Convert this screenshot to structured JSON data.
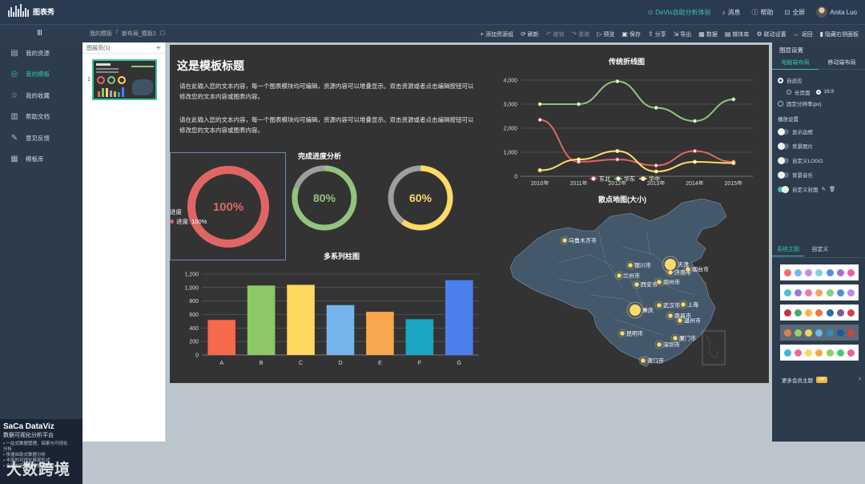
{
  "app": {
    "logo_text": "图表秀",
    "davis_link": "DeVis自助分析体验",
    "messages": "消息",
    "help": "帮助",
    "fullscreen": "全屏",
    "user": "Anita Luo"
  },
  "toolbar": {
    "home_icon": "Ⅲ",
    "breadcrumb": [
      "我的模板",
      "/",
      "新布局_模板2"
    ],
    "items": [
      {
        "icon": "+",
        "label": "添加资源组",
        "dim": false
      },
      {
        "icon": "⟳",
        "label": "刷新",
        "dim": false
      },
      {
        "icon": "↶",
        "label": "撤销",
        "dim": true
      },
      {
        "icon": "↷",
        "label": "重做",
        "dim": true
      },
      {
        "icon": "▷",
        "label": "预览",
        "dim": false
      },
      {
        "icon": "▣",
        "label": "保存",
        "dim": false
      },
      {
        "icon": "⇪",
        "label": "分享",
        "dim": false
      },
      {
        "icon": "⇲",
        "label": "导出",
        "dim": false
      },
      {
        "icon": "▦",
        "label": "数据",
        "dim": false
      },
      {
        "icon": "▤",
        "label": "媒体库",
        "dim": false
      },
      {
        "icon": "⚙",
        "label": "联动设置",
        "dim": false
      },
      {
        "icon": "←",
        "label": "返回",
        "dim": false
      },
      {
        "icon": "▮",
        "label": "隐藏右侧面板",
        "dim": false
      }
    ]
  },
  "sidebar": {
    "items": [
      {
        "icon": "▤",
        "label": "我的资源",
        "active": false
      },
      {
        "icon": "◎",
        "label": "我的模板",
        "active": true
      },
      {
        "icon": "☆",
        "label": "我的收藏",
        "active": false
      },
      {
        "icon": "▥",
        "label": "帮助文档",
        "active": false
      },
      {
        "icon": "✎",
        "label": "意见反馈",
        "active": false
      },
      {
        "icon": "▦",
        "label": "模板库",
        "active": false
      }
    ],
    "promo": {
      "title": "SaCa DataViz",
      "subtitle": "数据可视化分析平台",
      "lines": [
        "• 一站式数据管理、探索与可视化",
        "  分析",
        "• 快速自助式数据分析",
        "• 丰富的可视化展现形式",
        "• 全面的用户权限管理体系"
      ]
    },
    "watermark": "大数跨境"
  },
  "pages": {
    "header": "图层页(1)",
    "add": "+",
    "page_number": "1"
  },
  "dashboard": {
    "title": "这是模板标题",
    "paragraphs": [
      "请在此输入您的文本内容，每一个图表模块均可编辑，资源内容可以堆叠显示。双击资源或者点击编辑按钮可以修改您的文本内容或图表内容。",
      "请在此输入您的文本内容，每一个图表模块均可编辑，资源内容可以堆叠显示。双击资源或者点击编辑按钮可以修改您的文本内容或图表内容。"
    ],
    "progress_title": "完成进度分析",
    "tooltip_title": "进度",
    "tooltip_text": "进度: 100%",
    "gauges": [
      {
        "value": 100,
        "label": "100%",
        "color": "#e06666",
        "track": "#a94545"
      },
      {
        "value": 80,
        "label": "80%",
        "color": "#93c47d",
        "track": "#9e9e9e"
      },
      {
        "value": 60,
        "label": "60%",
        "color": "#ffd966",
        "track": "#9e9e9e"
      }
    ],
    "map_title": "散点地图(大小)",
    "map_cities": [
      {
        "name": "乌鲁木齐市",
        "big": false
      },
      {
        "name": "银川市",
        "big": false
      },
      {
        "name": "兰州市",
        "big": false
      },
      {
        "name": "西安市",
        "big": false
      },
      {
        "name": "郑州市",
        "big": false
      },
      {
        "name": "济南市",
        "big": false
      },
      {
        "name": "天津",
        "big": true
      },
      {
        "name": "烟台市",
        "big": false
      },
      {
        "name": "重庆",
        "big": true
      },
      {
        "name": "武汉市",
        "big": false
      },
      {
        "name": "上海",
        "big": false
      },
      {
        "name": "南昌市",
        "big": false
      },
      {
        "name": "温州市",
        "big": false
      },
      {
        "name": "昆明市",
        "big": false
      },
      {
        "name": "厦门市",
        "big": false
      },
      {
        "name": "深圳市",
        "big": false
      },
      {
        "name": "海口市",
        "big": false
      }
    ]
  },
  "chart_data": [
    {
      "type": "line",
      "title": "传统折线图",
      "categories": [
        "2010年",
        "2011年",
        "2012年",
        "2013年",
        "2014年",
        "2015年"
      ],
      "ylim": [
        0,
        4000
      ],
      "yticks": [
        "4,000",
        "3,000",
        "2,000",
        "1,000",
        "0"
      ],
      "grid": true,
      "legend_position": "bottom",
      "series": [
        {
          "name": "东北",
          "color": "#e06666",
          "values": [
            2350,
            600,
            700,
            450,
            1050,
            600
          ]
        },
        {
          "name": "华东",
          "color": "#93c47d",
          "values": [
            3000,
            3000,
            3950,
            2850,
            2300,
            3200
          ]
        },
        {
          "name": "华中",
          "color": "#ffd966",
          "values": [
            250,
            700,
            1050,
            200,
            600,
            550
          ]
        }
      ]
    },
    {
      "type": "bar",
      "title": "多系列柱图",
      "categories": [
        "A",
        "B",
        "C",
        "D",
        "E",
        "F",
        "G"
      ],
      "values": [
        520,
        1030,
        1040,
        740,
        640,
        530,
        1110
      ],
      "colors": [
        "#f6694b",
        "#8cc866",
        "#ffd75e",
        "#76b4ec",
        "#f9a74b",
        "#1ba6c3",
        "#4b7fec"
      ],
      "ylim": [
        0,
        1200
      ],
      "yticks": [
        "1,200",
        "1,000",
        "800",
        "600",
        "400",
        "200",
        "0"
      ],
      "grid": true
    }
  ],
  "right_panel": {
    "header": "图层设置",
    "tabs": [
      "电脑端布局",
      "移动端布局"
    ],
    "adaptive": "自适应",
    "long_page": "长页面",
    "ratio": "16:9",
    "fixed": "固定分辨率(px)",
    "playback": "播放设置",
    "toggles": [
      {
        "label": "显示边框",
        "on": false
      },
      {
        "label": "背景图片",
        "on": false
      },
      {
        "label": "自定义LOGO",
        "on": false
      },
      {
        "label": "背景音乐",
        "on": false
      },
      {
        "label": "自定义封面",
        "on": true
      }
    ],
    "theme_tabs": [
      "系统主题",
      "自定义"
    ],
    "themes": [
      [
        "#f26b6b",
        "#76b6ec",
        "#c58ce6",
        "#7ad2df",
        "#5a8de2",
        "#9c72e3",
        "#f25d9c"
      ],
      [
        "#45c1d4",
        "#9a76e6",
        "#f07aa0",
        "#f6a25a",
        "#7dd28c",
        "#4e8fe0",
        "#c08be1"
      ],
      [
        "#c3343f",
        "#4eaa66",
        "#f5b248",
        "#e57a42",
        "#2d6b9e",
        "#7a5a9d",
        "#d0463c"
      ],
      [
        "#e57b53",
        "#9bd06a",
        "#f7d35a",
        "#6bb9ec",
        "#2d8bc6",
        "#1a5aa2",
        "#d1443c"
      ],
      [
        "#40b5e0",
        "#f06a8c",
        "#f7dd57",
        "#f6a74b",
        "#8bd166",
        "#46c97b",
        "#e95e9a"
      ]
    ],
    "more_themes": "更多会员主题",
    "vip": "VIP"
  }
}
